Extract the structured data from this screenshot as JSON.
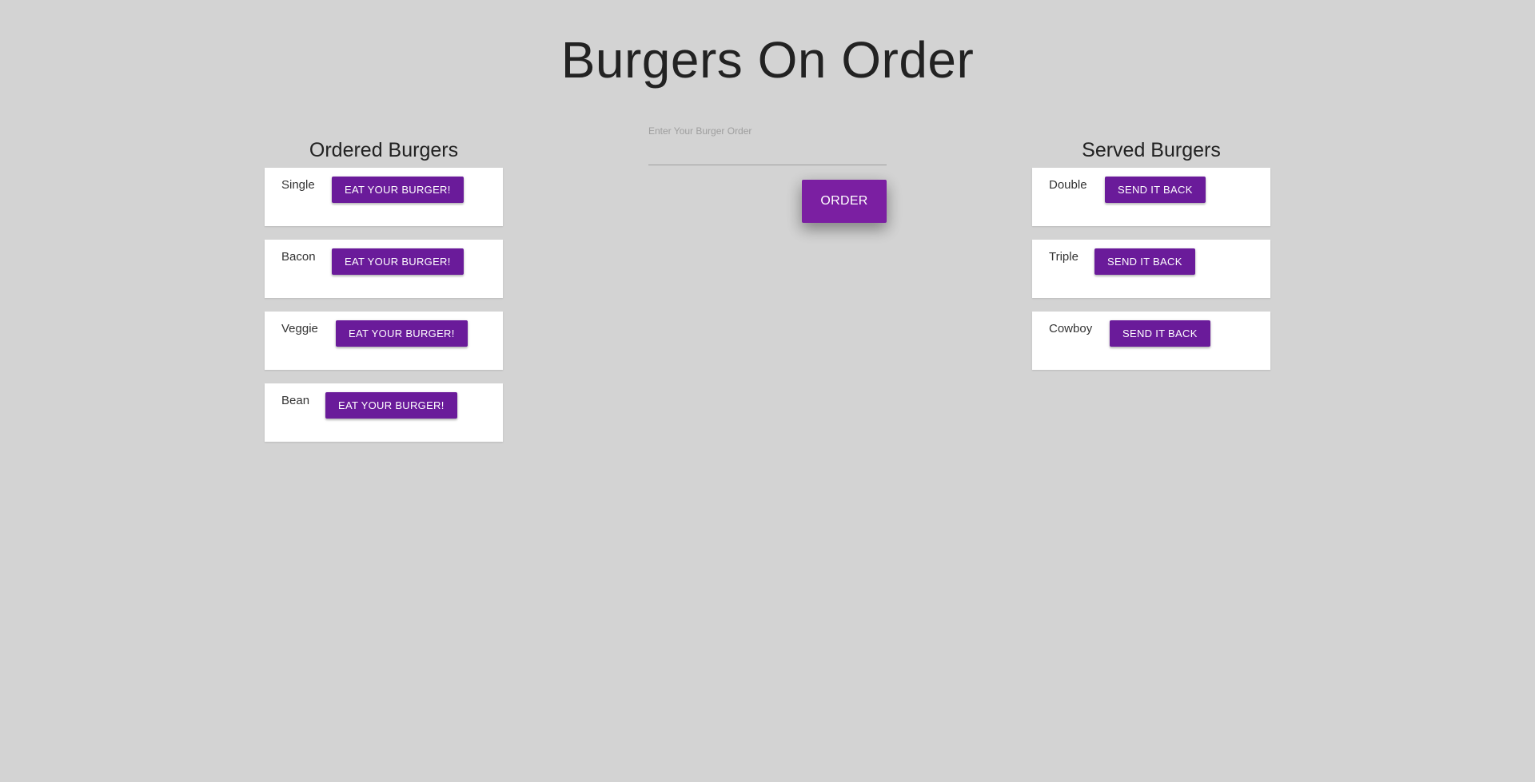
{
  "header": {
    "title": "Burgers On Order"
  },
  "ordered": {
    "heading": "Ordered Burgers",
    "items": [
      {
        "name": "Single",
        "button": "EAT YOUR BURGER!"
      },
      {
        "name": "Bacon",
        "button": "EAT YOUR BURGER!"
      },
      {
        "name": "Veggie",
        "button": "EAT YOUR BURGER!"
      },
      {
        "name": "Bean",
        "button": "EAT YOUR BURGER!"
      }
    ]
  },
  "order_form": {
    "label": "Enter Your Burger Order",
    "value": "",
    "button": "ORDER"
  },
  "served": {
    "heading": "Served Burgers",
    "items": [
      {
        "name": "Double",
        "button": "SEND IT BACK"
      },
      {
        "name": "Triple",
        "button": "SEND IT BACK"
      },
      {
        "name": "Cowboy",
        "button": "SEND IT BACK"
      }
    ]
  },
  "colors": {
    "background": "#d3d3d3",
    "button": "#6a1b9a",
    "order_button": "#7b1fa2",
    "card": "#ffffff"
  }
}
